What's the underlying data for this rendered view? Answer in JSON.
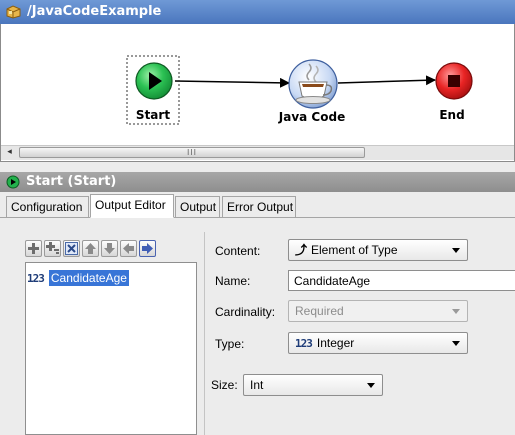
{
  "window": {
    "title": "/JavaCodeExample"
  },
  "flow": {
    "nodes": [
      {
        "id": "start",
        "label": "Start"
      },
      {
        "id": "java",
        "label": "Java Code"
      },
      {
        "id": "end",
        "label": "End"
      }
    ]
  },
  "scrollbar": {
    "left_arrow": "◂",
    "thumb_grip": "III"
  },
  "properties": {
    "title": "Start (Start)",
    "tabs": [
      {
        "label": "Configuration"
      },
      {
        "label": "Output Editor",
        "active": true
      },
      {
        "label": "Output"
      },
      {
        "label": "Error Output"
      }
    ]
  },
  "toolbar": {
    "icons": [
      "add-icon",
      "add-child-icon",
      "delete-icon",
      "move-up-icon",
      "move-down-icon",
      "move-left-icon",
      "move-right-icon"
    ]
  },
  "tree": {
    "items": [
      {
        "type_icon": "123",
        "label": "CandidateAge",
        "selected": true
      }
    ]
  },
  "form": {
    "content_label": "Content:",
    "content_value": "Element of Type",
    "name_label": "Name:",
    "name_value": "CandidateAge",
    "cardinality_label": "Cardinality:",
    "cardinality_value": "Required",
    "type_label": "Type:",
    "type_icon": "123",
    "type_value": "Integer",
    "size_label": "Size:",
    "size_value": "Int"
  },
  "colors": {
    "title_bar": "#4a76bd",
    "start_node": "#1fb34a",
    "end_node": "#e02020",
    "selection": "#3875d7"
  }
}
